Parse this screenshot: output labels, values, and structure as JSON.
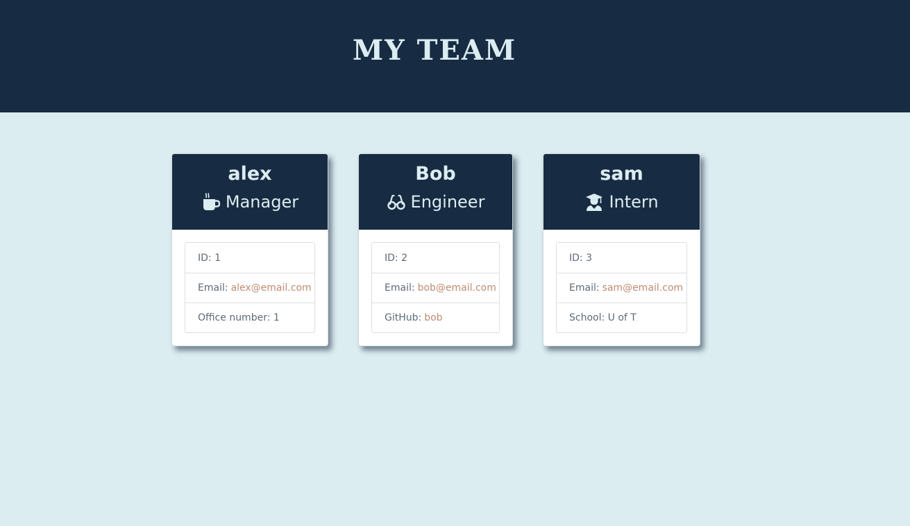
{
  "header": {
    "title": "MY TEAM",
    "background_color": "#172b42",
    "title_color": "#dcedf1"
  },
  "page": {
    "background_color": "#dcedf1"
  },
  "cards": [
    {
      "name": "alex",
      "role": "Manager",
      "role_icon": "coffee-mug-icon",
      "id_label": "ID:",
      "id_value": "1",
      "email_label": "Email:",
      "email": "alex@email.com",
      "extra_label": "Office number:",
      "extra_value": "1"
    },
    {
      "name": "Bob",
      "role": "Engineer",
      "role_icon": "glasses-icon",
      "id_label": "ID:",
      "id_value": "2",
      "email_label": "Email:",
      "email": "bob@email.com",
      "extra_label": "GitHub:",
      "extra_value": "bob"
    },
    {
      "name": "sam",
      "role": "Intern",
      "role_icon": "graduate-icon",
      "id_label": "ID:",
      "id_value": "3",
      "email_label": "Email:",
      "email": "sam@email.com",
      "extra_label": "School:",
      "extra_value": "U of T"
    }
  ],
  "colors": {
    "card_header": "#172b42",
    "link": "#c08a72",
    "text": "#5d6a76"
  }
}
